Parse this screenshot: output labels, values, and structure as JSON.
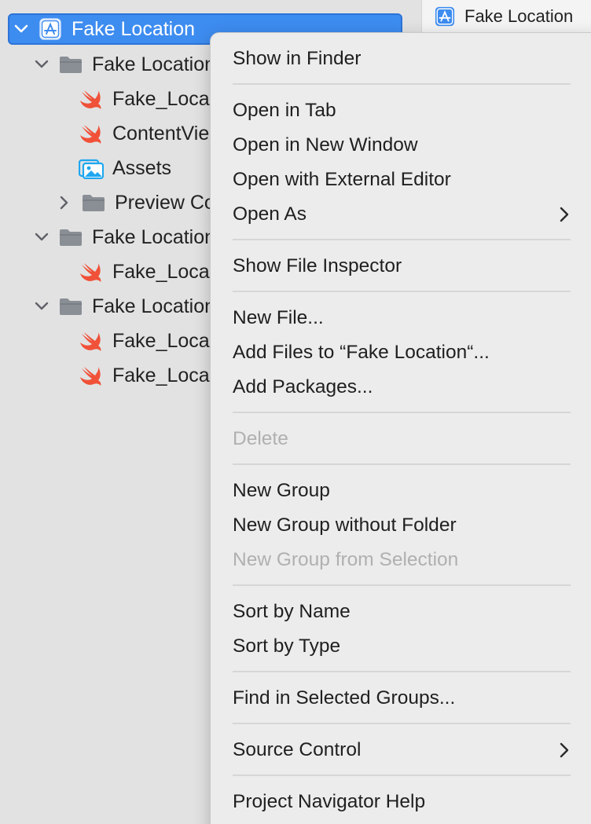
{
  "navigator": {
    "rows": [
      {
        "label": "Fake Location",
        "icon": "xcode-project-icon"
      },
      {
        "label": "Fake Location",
        "icon": "folder-icon"
      },
      {
        "label": "Fake_Loca",
        "icon": "swift-file-icon"
      },
      {
        "label": "ContentVie",
        "icon": "swift-file-icon"
      },
      {
        "label": "Assets",
        "icon": "asset-catalog-icon"
      },
      {
        "label": "Preview Co",
        "icon": "folder-icon"
      },
      {
        "label": "Fake Location",
        "icon": "folder-icon"
      },
      {
        "label": "Fake_Loca",
        "icon": "swift-file-icon"
      },
      {
        "label": "Fake Location",
        "icon": "folder-icon"
      },
      {
        "label": "Fake_Loca",
        "icon": "swift-file-icon"
      },
      {
        "label": "Fake_Loca",
        "icon": "swift-file-icon"
      }
    ]
  },
  "editor_tab": {
    "label": "Fake Location",
    "icon": "xcode-project-icon"
  },
  "context_menu": {
    "items": [
      {
        "label": "Show in Finder",
        "enabled": true
      },
      {
        "label": "Open in Tab",
        "enabled": true
      },
      {
        "label": "Open in New Window",
        "enabled": true
      },
      {
        "label": "Open with External Editor",
        "enabled": true
      },
      {
        "label": "Open As",
        "enabled": true,
        "submenu": true
      },
      {
        "label": "Show File Inspector",
        "enabled": true
      },
      {
        "label": "New File...",
        "enabled": true
      },
      {
        "label": "Add Files to “Fake Location“...",
        "enabled": true
      },
      {
        "label": "Add Packages...",
        "enabled": true
      },
      {
        "label": "Delete",
        "enabled": false
      },
      {
        "label": "New Group",
        "enabled": true
      },
      {
        "label": "New Group without Folder",
        "enabled": true
      },
      {
        "label": "New Group from Selection",
        "enabled": false
      },
      {
        "label": "Sort by Name",
        "enabled": true
      },
      {
        "label": "Sort by Type",
        "enabled": true
      },
      {
        "label": "Find in Selected Groups...",
        "enabled": true
      },
      {
        "label": "Source Control",
        "enabled": true,
        "submenu": true
      },
      {
        "label": "Project Navigator Help",
        "enabled": true
      }
    ]
  },
  "colors": {
    "selection": "#3d8cf0",
    "swift_orange": "#f05138",
    "folder_gray": "#8a8f96",
    "asset_blue": "#1ea7f0",
    "disabled_text": "#b0b0b0"
  }
}
